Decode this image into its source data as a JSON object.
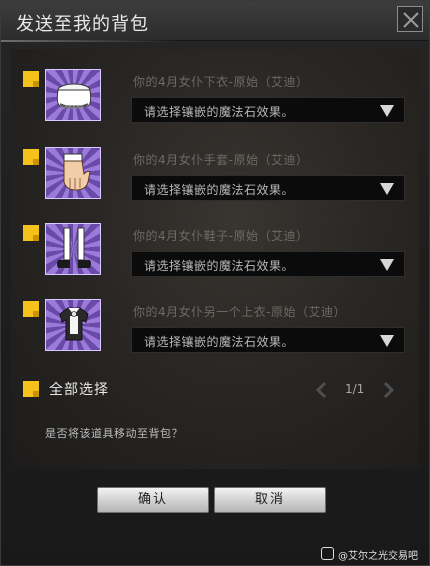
{
  "dialog": {
    "title": "发送至我的背包",
    "close_icon": "close-icon"
  },
  "items": [
    {
      "name": "你的4月女仆下衣-原始（艾迪）",
      "select_placeholder": "请选择镶嵌的魔法石效果。",
      "icon": "skirt-icon"
    },
    {
      "name": "你的4月女仆手套-原始（艾迪）",
      "select_placeholder": "请选择镶嵌的魔法石效果。",
      "icon": "glove-icon"
    },
    {
      "name": "你的4月女仆鞋子-原始（艾迪）",
      "select_placeholder": "请选择镶嵌的魔法石效果。",
      "icon": "shoes-icon"
    },
    {
      "name": "你的4月女仆另一个上衣-原始（艾迪）",
      "select_placeholder": "请选择镶嵌的魔法石效果。",
      "icon": "top-icon"
    }
  ],
  "select_all": {
    "label": "全部选择"
  },
  "pager": {
    "text": "1/1"
  },
  "question": "是否将该道具移动至背包？",
  "buttons": {
    "confirm": "确认",
    "cancel": "取消"
  },
  "watermark": {
    "text": "@艾尔之光交易吧"
  },
  "colors": {
    "accent": "#f4c21a",
    "thumb_purple": "#9b7ad9"
  }
}
